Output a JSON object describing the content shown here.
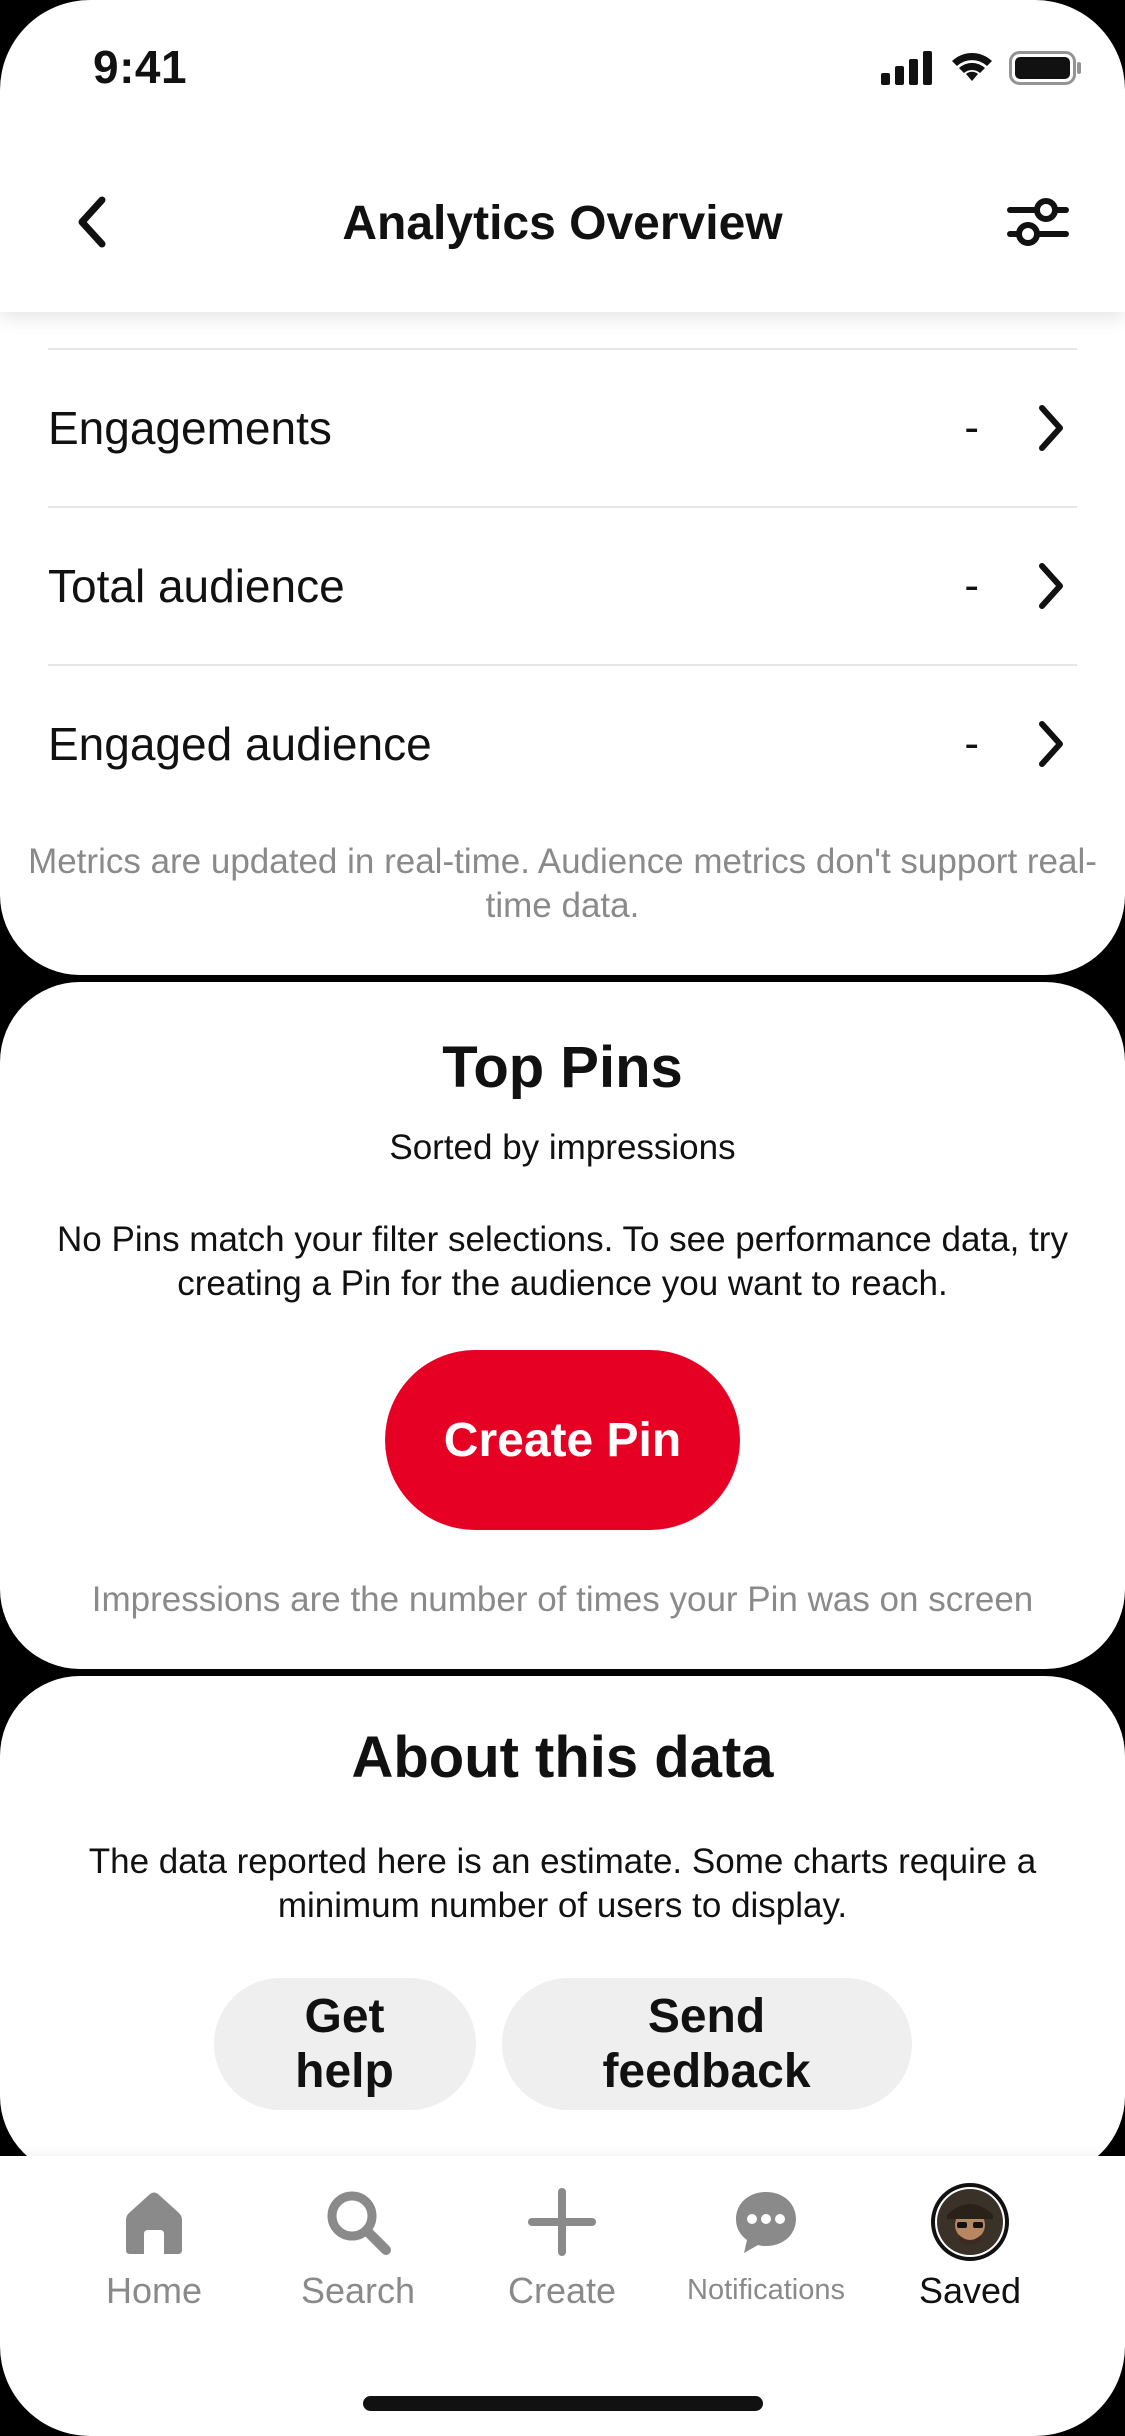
{
  "status_bar": {
    "time": "9:41"
  },
  "header": {
    "title": "Analytics Overview",
    "back_icon": "chevron-left-icon",
    "filter_icon": "sliders-icon"
  },
  "metrics": {
    "rows": [
      {
        "label": "Engagements",
        "value": "-"
      },
      {
        "label": "Total audience",
        "value": "-"
      },
      {
        "label": "Engaged audience",
        "value": "-"
      }
    ],
    "note": "Metrics are updated in real-time. Audience metrics don't support real-time data."
  },
  "top_pins": {
    "title": "Top Pins",
    "subtitle": "Sorted by impressions",
    "message": "No Pins match your filter selections. To see performance data, try creating a Pin for the audience you want to reach.",
    "create_button": "Create Pin",
    "note": "Impressions are the number of times your Pin was on screen"
  },
  "about": {
    "title": "About this data",
    "text": "The data reported here is an estimate. Some charts require a minimum number of users to display.",
    "help_button": "Get help",
    "feedback_button": "Send feedback"
  },
  "tabbar": {
    "items": [
      {
        "label": "Home",
        "icon": "home-icon",
        "active": false
      },
      {
        "label": "Search",
        "icon": "search-icon",
        "active": false
      },
      {
        "label": "Create",
        "icon": "plus-icon",
        "active": false
      },
      {
        "label": "Notifications",
        "icon": "chat-bubble-icon",
        "active": false
      },
      {
        "label": "Saved",
        "icon": "avatar",
        "active": true
      }
    ]
  },
  "colors": {
    "brand_red": "#e60023",
    "text_primary": "#111111",
    "text_muted": "#8a8a8a",
    "pill_bg": "#efefef"
  }
}
